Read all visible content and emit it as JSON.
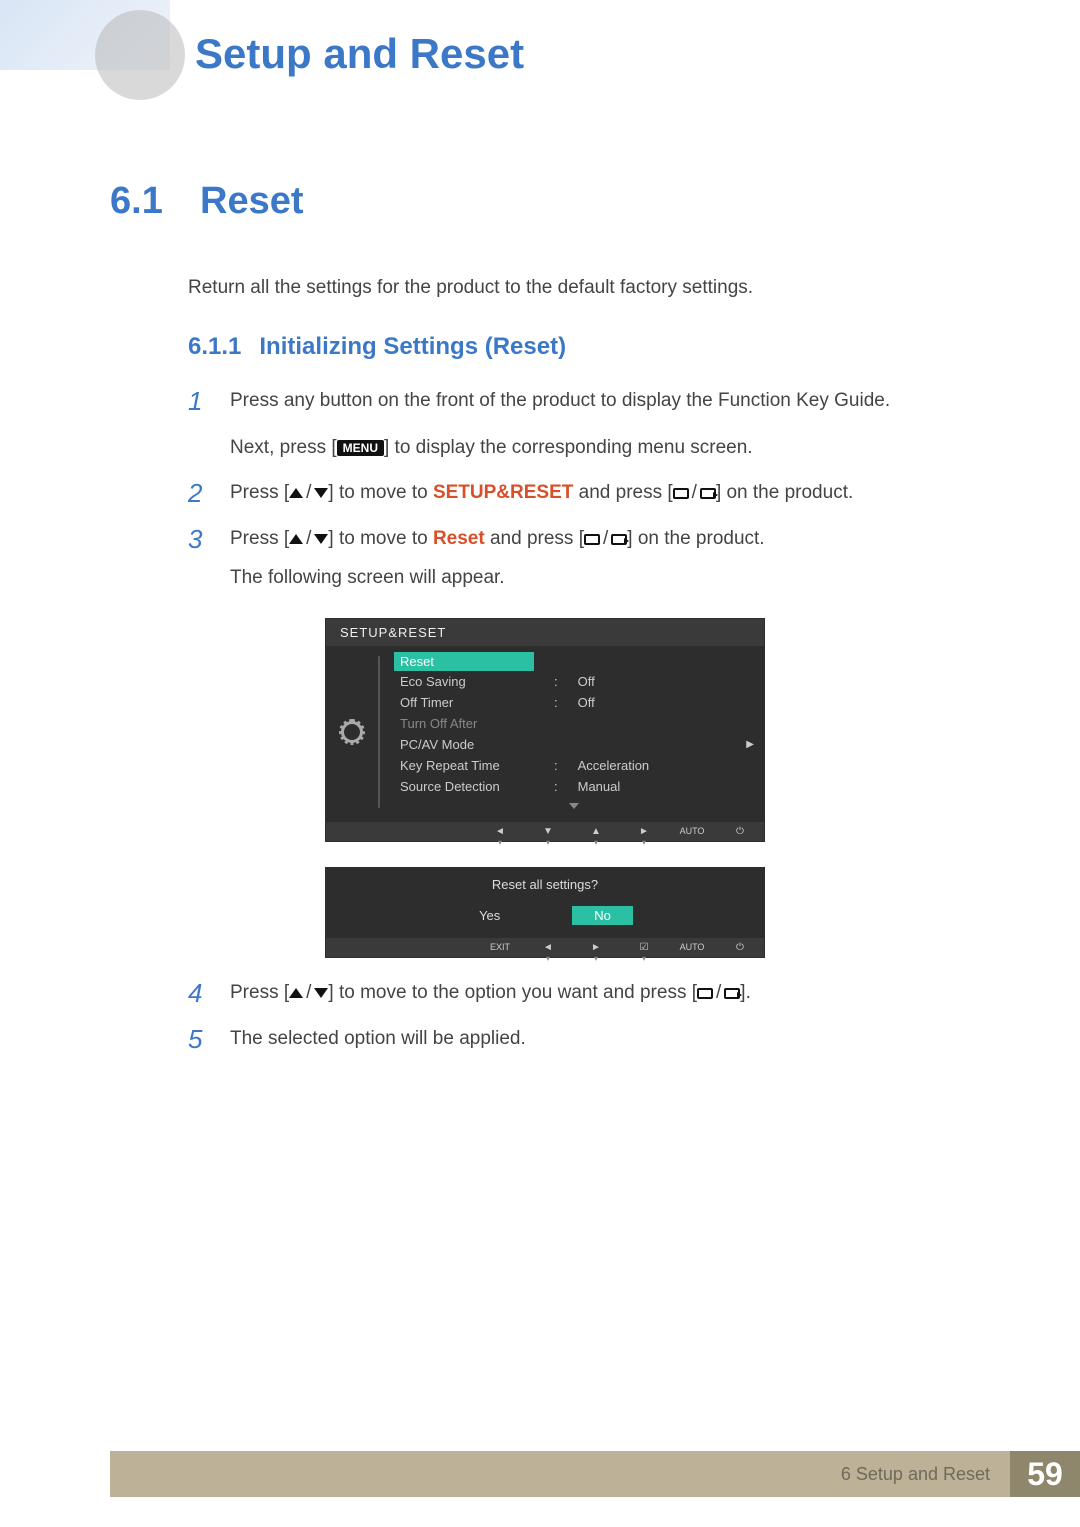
{
  "chapter_title": "Setup and Reset",
  "section": {
    "num": "6.1",
    "title": "Reset"
  },
  "section_intro": "Return all the settings for the product to the default factory settings.",
  "subsection": {
    "num": "6.1.1",
    "title": "Initializing Settings (Reset)"
  },
  "steps": {
    "s1": {
      "num": "1",
      "line1": "Press any button on the front of the product to display the Function Key Guide.",
      "line2_pre": "Next, press [",
      "menu_chip": "MENU",
      "line2_post": "] to display the corresponding menu screen."
    },
    "s2": {
      "num": "2",
      "pre": "Press [",
      "mid": "] to move to ",
      "keyword": "SETUP&RESET",
      "aft": " and press [",
      "tail": "] on the product."
    },
    "s3": {
      "num": "3",
      "pre": "Press [",
      "mid": "] to move to ",
      "keyword": "Reset",
      "aft": " and press [",
      "tail": "] on the product.",
      "sub": "The following screen will appear."
    },
    "s4": {
      "num": "4",
      "pre": "Press [",
      "mid": "] to move to the option you want and press [",
      "tail": "]."
    },
    "s5": {
      "num": "5",
      "text": "The selected option will be applied."
    }
  },
  "osd1": {
    "header": "SETUP&RESET",
    "items": [
      {
        "label": "Reset",
        "value": "",
        "sel": true
      },
      {
        "label": "Eco Saving",
        "value": "Off"
      },
      {
        "label": "Off Timer",
        "value": "Off"
      },
      {
        "label": "Turn Off After",
        "value": "",
        "dim": true
      },
      {
        "label": "PC/AV Mode",
        "value": "",
        "arrow": true
      },
      {
        "label": "Key Repeat Time",
        "value": "Acceleration"
      },
      {
        "label": "Source Detection",
        "value": "Manual"
      }
    ],
    "footer_auto": "AUTO"
  },
  "osd2": {
    "question": "Reset all settings?",
    "yes": "Yes",
    "no": "No",
    "exit": "EXIT",
    "auto": "AUTO"
  },
  "footer": {
    "chapter_full": "6 Setup and Reset",
    "page_num": "59"
  }
}
